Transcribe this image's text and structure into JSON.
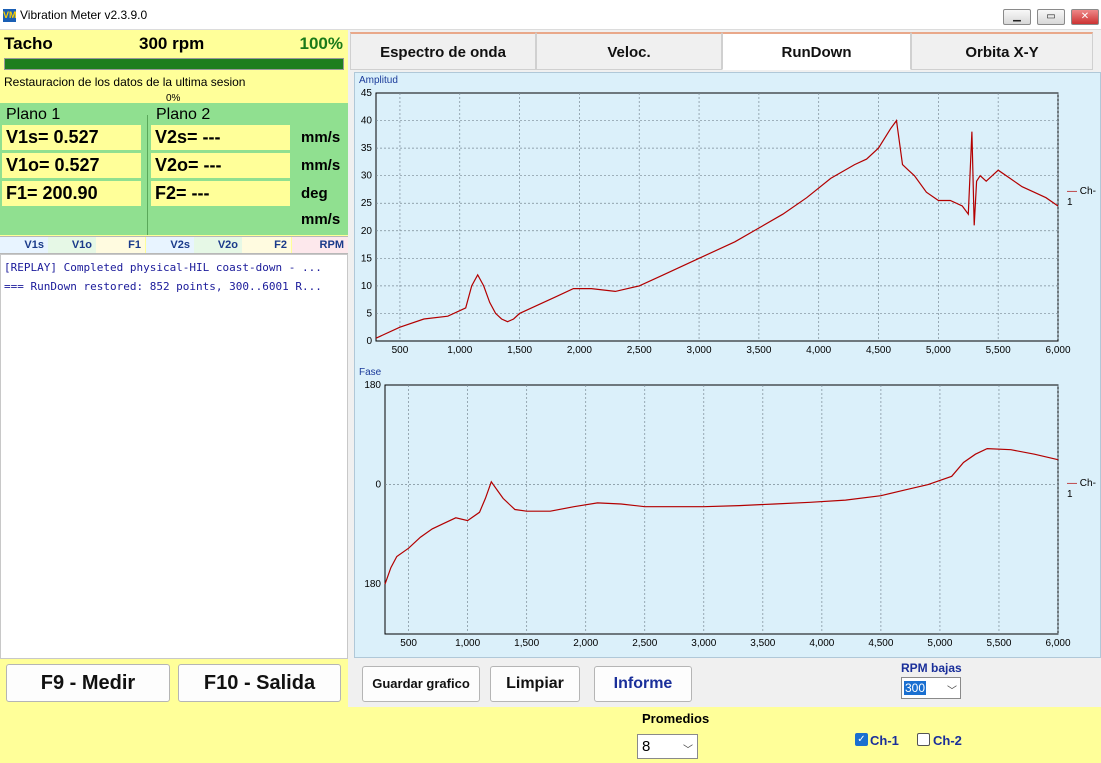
{
  "window": {
    "title": "Vibration Meter v2.3.9.0",
    "icon": "VM",
    "controls": [
      "minimize-icon",
      "maximize-icon",
      "close-icon"
    ]
  },
  "tacho": {
    "label": "Tacho",
    "rpm": "300 rpm",
    "percent": "100%",
    "progress": 1.0
  },
  "status": {
    "message": "Restauracion de los datos de la ultima sesion",
    "percent": "0%"
  },
  "plane1": {
    "title": "Plano 1",
    "v1s": "V1s= 0.527",
    "v1o": "V1o= 0.527",
    "f1": "F1= 200.90"
  },
  "plane2": {
    "title": "Plano 2",
    "v2s": "V2s= ---",
    "v2o": "V2o= ---",
    "f2": "F2= ---"
  },
  "units": [
    "mm/s",
    "mm/s",
    "deg",
    "mm/s"
  ],
  "chips": [
    "V1s",
    "V1o",
    "F1",
    "V2s",
    "V2o",
    "F2",
    "RPM"
  ],
  "log": [
    "[REPLAY] Completed physical-HIL coast-down - ...",
    "=== RunDown restored: 852 points, 300..6001 R..."
  ],
  "buttons": {
    "measure": "F9 - Medir",
    "exit": "F10 - Salida",
    "save": "Guardar grafico",
    "clear": "Limpiar",
    "report": "Informe"
  },
  "tabs": [
    {
      "label": "Espectro de onda",
      "active": false
    },
    {
      "label": "Veloc.",
      "active": false
    },
    {
      "label": "RunDown",
      "active": true
    },
    {
      "label": "Orbita X-Y",
      "active": false
    }
  ],
  "rpm_low": {
    "label": "RPM bajas",
    "value": "300"
  },
  "averages": {
    "label": "Promedios",
    "value": "8"
  },
  "channels": [
    {
      "label": "Ch-1",
      "checked": true
    },
    {
      "label": "Ch-2",
      "checked": false
    }
  ],
  "colors": {
    "accent": "#1a6fd0",
    "trace": "#b30000",
    "plot_bg": "#dbf0fa",
    "panel_yellow": "#ffff99",
    "panel_green": "#90e090"
  },
  "chart_data": [
    {
      "type": "line",
      "title": "Amplitud",
      "xlim": [
        300,
        6000
      ],
      "ylim": [
        0,
        45
      ],
      "xticks": [
        "500",
        "1,000",
        "1,500",
        "2,000",
        "2,500",
        "3,000",
        "3,500",
        "4,000",
        "4,500",
        "5,000",
        "5,500",
        "6,000"
      ],
      "yticks": [
        "0",
        "5",
        "10",
        "15",
        "20",
        "25",
        "30",
        "35",
        "40",
        "45"
      ],
      "grid": true,
      "legend": "right",
      "series": [
        {
          "name": "Ch-1",
          "x": [
            300,
            500,
            700,
            900,
            1050,
            1100,
            1150,
            1200,
            1250,
            1300,
            1350,
            1400,
            1450,
            1500,
            1600,
            1800,
            1950,
            2100,
            2300,
            2500,
            2700,
            3000,
            3300,
            3500,
            3700,
            3900,
            4100,
            4300,
            4400,
            4500,
            4600,
            4650,
            4700,
            4750,
            4800,
            4900,
            5000,
            5100,
            5200,
            5250,
            5280,
            5300,
            5320,
            5350,
            5400,
            5450,
            5500,
            5600,
            5700,
            5800,
            5900,
            6000
          ],
          "y": [
            0.5,
            2.5,
            4,
            4.5,
            6,
            10,
            12,
            10,
            7,
            5,
            4,
            3.5,
            4,
            5,
            6,
            8,
            9.5,
            9.5,
            9,
            10,
            12,
            15,
            18,
            20.5,
            23,
            26,
            29.5,
            32,
            33,
            35,
            38.5,
            40,
            32,
            31,
            30,
            27,
            25.5,
            25.5,
            24.5,
            23,
            38,
            21,
            29,
            30,
            29,
            30,
            31,
            29.5,
            28,
            27,
            26,
            24.5
          ]
        }
      ]
    },
    {
      "type": "line",
      "title": "Fase",
      "xlim": [
        300,
        6000
      ],
      "yticks": [
        "180",
        "0",
        "180"
      ],
      "xticks": [
        "500",
        "1,000",
        "1,500",
        "2,000",
        "2,500",
        "3,000",
        "3,500",
        "4,000",
        "4,500",
        "5,000",
        "5,500",
        "6,000"
      ],
      "grid": true,
      "legend": "right",
      "series": [
        {
          "name": "Ch-1",
          "x": [
            300,
            350,
            400,
            500,
            600,
            700,
            800,
            900,
            1000,
            1100,
            1150,
            1200,
            1250,
            1300,
            1350,
            1400,
            1500,
            1700,
            1900,
            2100,
            2300,
            2500,
            2700,
            3000,
            3300,
            3600,
            3900,
            4200,
            4500,
            4700,
            4900,
            5100,
            5200,
            5300,
            5400,
            5600,
            5800,
            6000
          ],
          "y": [
            -180,
            -150,
            -130,
            -115,
            -95,
            -80,
            -70,
            -60,
            -65,
            -50,
            -25,
            5,
            -10,
            -25,
            -35,
            -45,
            -48,
            -48,
            -40,
            -33,
            -35,
            -40,
            -40,
            -40,
            -38,
            -35,
            -32,
            -28,
            -20,
            -10,
            0,
            15,
            40,
            55,
            65,
            63,
            55,
            45
          ]
        }
      ]
    }
  ]
}
